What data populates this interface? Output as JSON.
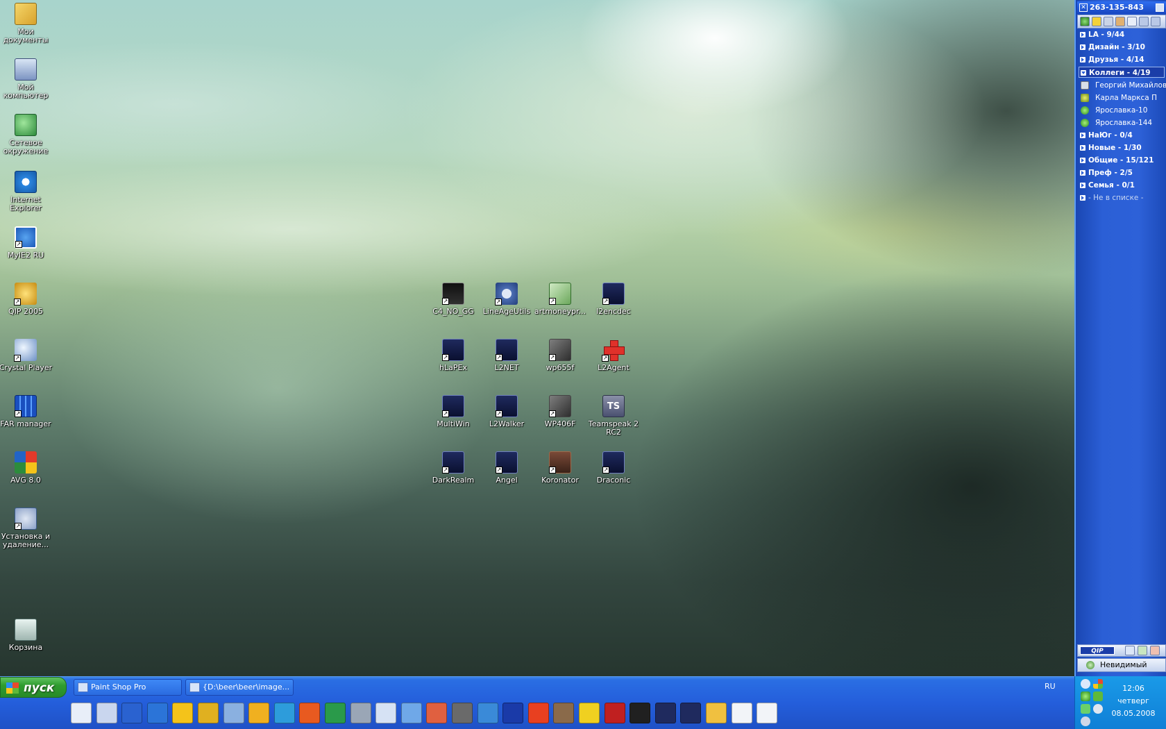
{
  "desktop": {
    "left_icons": [
      {
        "label": "Мои документы",
        "icon": "my-documents-icon"
      },
      {
        "label": "Мой компьютер",
        "icon": "my-computer-icon"
      },
      {
        "label": "Сетевое окружение",
        "icon": "network-icon"
      },
      {
        "label": "Internet Explorer",
        "icon": "internet-explorer-icon"
      },
      {
        "label": "MyIE2 RU",
        "icon": "myie-icon"
      },
      {
        "label": "QIP 2005",
        "icon": "qip-icon"
      },
      {
        "label": "Crystal Player",
        "icon": "crystal-player-icon"
      },
      {
        "label": "FAR manager",
        "icon": "far-manager-icon"
      },
      {
        "label": "AVG 8.0",
        "icon": "avg-icon"
      },
      {
        "label": "Установка и удаление...",
        "icon": "add-remove-icon"
      },
      {
        "label": "Корзина",
        "icon": "recycle-bin-icon"
      }
    ],
    "center_icons": [
      {
        "label": "C4_NO_GG"
      },
      {
        "label": "LineAgeUtils"
      },
      {
        "label": "artmoneypr..."
      },
      {
        "label": "l2encdec"
      },
      {
        "label": "hLaPEx"
      },
      {
        "label": "L2NET"
      },
      {
        "label": "wp655f"
      },
      {
        "label": "L2Agent"
      },
      {
        "label": "MultiWin"
      },
      {
        "label": "L2Walker"
      },
      {
        "label": "WP406F"
      },
      {
        "label": "Teamspeak 2 RC2"
      },
      {
        "label": "DarkRealm"
      },
      {
        "label": "Angel"
      },
      {
        "label": "Koronator"
      },
      {
        "label": "Draconic"
      }
    ]
  },
  "taskbar": {
    "start_label": "пуск",
    "tasks": [
      {
        "label": "Paint Shop Pro"
      },
      {
        "label": "{D:\\beer\\beer\\image..."
      }
    ],
    "language": "RU",
    "quick_launch": [
      "outlook-icon",
      "show-desktop-icon",
      "far-manager-icon",
      "myie-icon",
      "batman-icon",
      "qip-icon",
      "crystal-player-icon",
      "winamp-icon",
      "feather-icon",
      "paint-icon",
      "paint4-icon",
      "eye-icon",
      "calculator-icon",
      "notepad-icon",
      "picasa-icon",
      "bim-icon",
      "globe-icon",
      "mirc-icon",
      "firewall-icon",
      "reel-icon",
      "yellow-letter-icon",
      "regedit-icon",
      "terminal-icon",
      "lineage-icon",
      "lineage2-icon",
      "envelope-icon",
      "window-icon",
      "window2-icon"
    ]
  },
  "clock": {
    "time": "12:06",
    "day": "четверг",
    "date": "08.05.2008"
  },
  "qip": {
    "uin": "263-135-843",
    "groups_before": [
      {
        "label": "LA - 9/44"
      },
      {
        "label": "Дизайн - 3/10"
      },
      {
        "label": "Друзья - 4/14"
      }
    ],
    "open_group": {
      "label": "Коллеги - 4/19"
    },
    "contacts": [
      {
        "label": "Георгий Михайлович"
      },
      {
        "label": "Карла Маркса П"
      },
      {
        "label": "Ярославка-10"
      },
      {
        "label": "Ярославка-144"
      }
    ],
    "groups_after": [
      {
        "label": "НаЮг - 0/4"
      },
      {
        "label": "Новые - 1/30"
      },
      {
        "label": "Общие - 15/121"
      },
      {
        "label": "Преф - 2/5"
      },
      {
        "label": "Семья - 0/1"
      },
      {
        "label": "- Не в списке -"
      }
    ],
    "logo": "QIP",
    "status": "Невидимый"
  },
  "colors": {
    "taskbar_blue": "#245edb",
    "start_green": "#2f9c2f",
    "qip_blue": "#2b5fd6"
  }
}
